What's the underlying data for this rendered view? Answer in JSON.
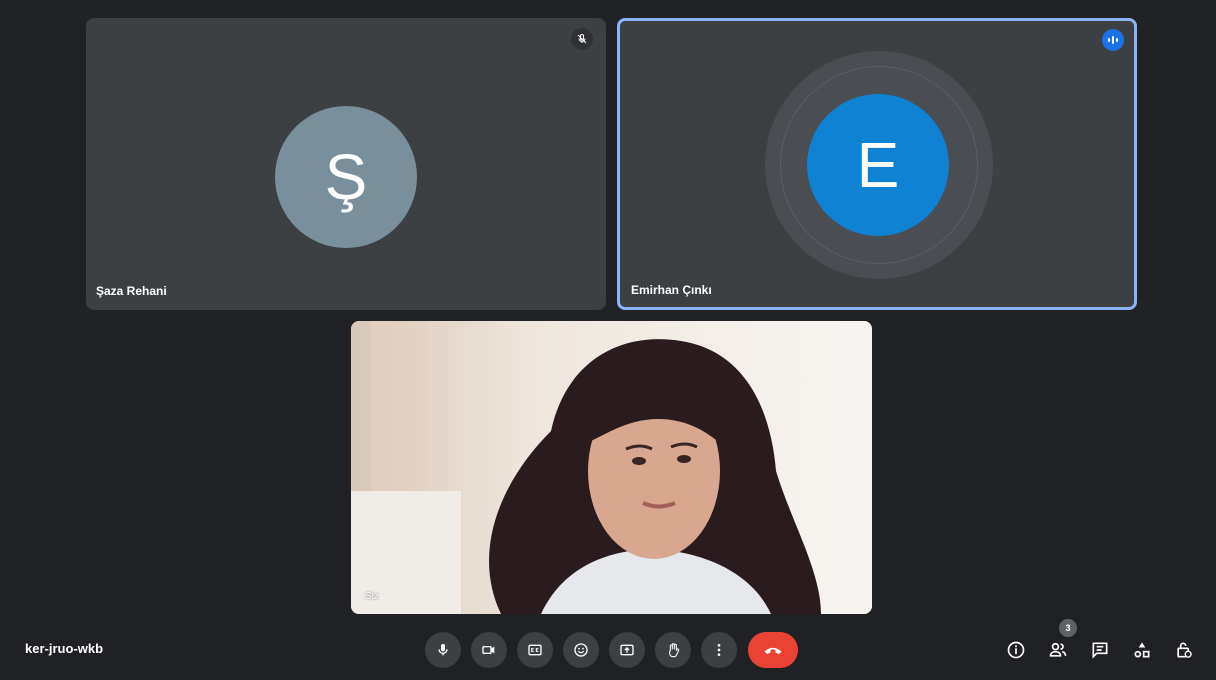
{
  "participants": [
    {
      "name": "Şaza Rehani",
      "initial": "Ş",
      "avatar_color": "#7a8f9c",
      "muted": true
    },
    {
      "name": "Emirhan Çınkı",
      "initial": "E",
      "avatar_color": "#0f82d4",
      "speaking": true
    }
  ],
  "self_view": {
    "label": "Siz"
  },
  "meeting": {
    "code": "ker-jruo-wkb"
  },
  "controls": {
    "icons": [
      "microphone-icon",
      "camera-icon",
      "captions-icon",
      "emoji-icon",
      "present-icon",
      "raise-hand-icon",
      "more-options-icon",
      "hang-up-icon"
    ],
    "hang_up_color": "#ea4335"
  },
  "side_controls": {
    "people_count": "3",
    "icons": [
      "info-icon",
      "people-icon",
      "chat-icon",
      "activities-icon",
      "host-controls-icon"
    ]
  },
  "colors": {
    "background": "#202124",
    "tile": "#3c4043",
    "active_border": "#8ab4f8"
  }
}
